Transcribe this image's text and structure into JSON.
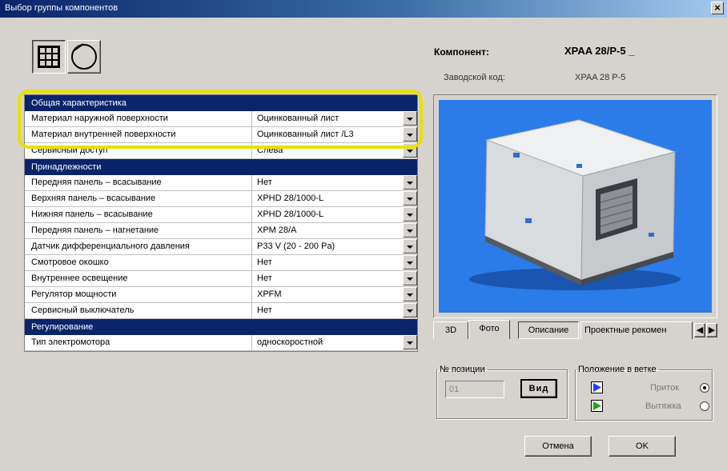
{
  "window": {
    "title": "Выбор группы компонентов",
    "close_label": "×"
  },
  "component": {
    "label": "Компонент:",
    "value": "XPAA 28/P-5 _",
    "code_label": "Заводской код:",
    "code_value": "XPAA 28  P-5"
  },
  "properties": [
    {
      "type": "category",
      "name": "Общая характеристика"
    },
    {
      "type": "item",
      "name": "Материал наружной поверхности",
      "value": "Оцинкованный лист",
      "dropdown": true
    },
    {
      "type": "item",
      "name": "Материал внутренней поверхности",
      "value": "Оцинкованный лист /L3",
      "dropdown": true
    },
    {
      "type": "item",
      "name": "Сервисный доступ",
      "value": "Слева",
      "dropdown": true
    },
    {
      "type": "category",
      "name": "Принадлежности"
    },
    {
      "type": "item",
      "name": "Передняя панель – всасывание",
      "value": "Нет",
      "dropdown": true
    },
    {
      "type": "item",
      "name": "Верхняя панель – всасывание",
      "value": "XPHD 28/1000-L",
      "dropdown": true
    },
    {
      "type": "item",
      "name": "Нижняя панель – всасывание",
      "value": "XPHD 28/1000-L",
      "dropdown": true
    },
    {
      "type": "item",
      "name": "Передняя панель – нагнетание",
      "value": "XPM 28/A",
      "dropdown": true
    },
    {
      "type": "item",
      "name": "Датчик дифференциального давления",
      "value": "P33 V (20 - 200 Pa)",
      "dropdown": true
    },
    {
      "type": "item",
      "name": "Смотровое окошко",
      "value": "Нет",
      "dropdown": true
    },
    {
      "type": "item",
      "name": "Внутреннее освещение",
      "value": "Нет",
      "dropdown": true
    },
    {
      "type": "item",
      "name": "Регулятор мощности",
      "value": "XPFM",
      "dropdown": true
    },
    {
      "type": "item",
      "name": "Сервисный выключатель",
      "value": "Нет",
      "dropdown": true
    },
    {
      "type": "category",
      "name": "Регулирование"
    },
    {
      "type": "item",
      "name": "Тип электромотора",
      "value": "односкоростной",
      "dropdown": true
    }
  ],
  "tabs": [
    "3D",
    "Фото",
    "Описание",
    "Проектные рекомен"
  ],
  "active_tab": 1,
  "position_group": {
    "legend": "№ позиции",
    "value": "01",
    "button_label": "Вид"
  },
  "branch_group": {
    "legend": "Положение в ветке",
    "options": [
      {
        "label": "Приток",
        "selected": true,
        "color": "#1f3fff"
      },
      {
        "label": "Вытяжка",
        "selected": false,
        "color": "#1aa81a"
      }
    ]
  },
  "buttons": {
    "cancel": "Отмена",
    "ok": "OK"
  },
  "colors": {
    "category_bg": "#0a246a",
    "image_bg": "#2b7be8",
    "highlight": "#e8e000"
  }
}
